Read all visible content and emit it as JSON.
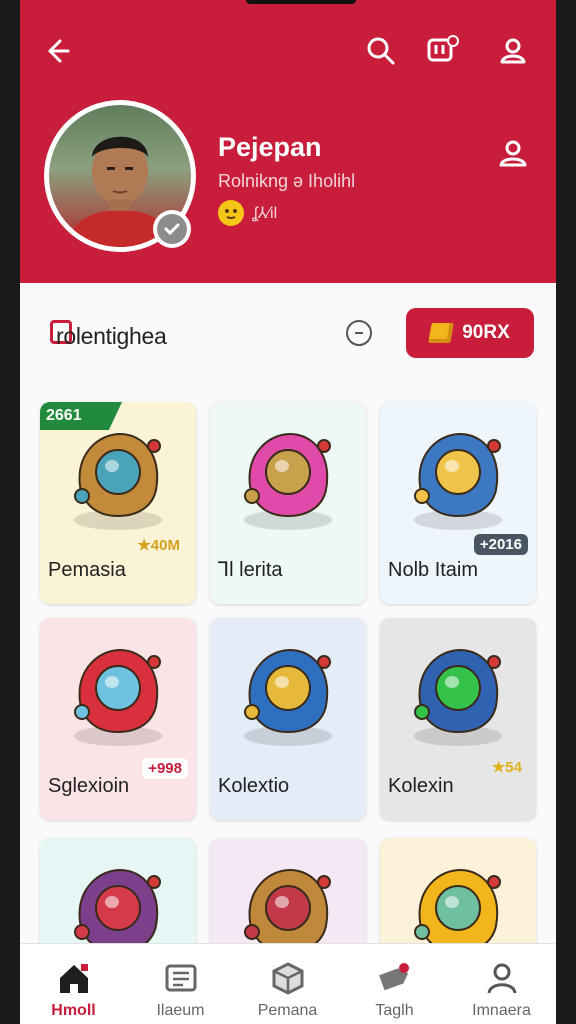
{
  "header": {
    "user_name": "Pejepan",
    "user_subtitle": "Rolnikng ə Iholihl",
    "status_text": "ʆ⅄∕il"
  },
  "section": {
    "title": "rolentighea",
    "buy_button_label": "90RX"
  },
  "items": [
    {
      "label": "Pemasia",
      "ribbon": "2661",
      "price": "★40M",
      "bg": "#fbf3d6"
    },
    {
      "label": "Ꞁl lerita",
      "bg": "#eef8f4"
    },
    {
      "label": "Nolb Itaim",
      "price": "+2016",
      "bg": "#eef5fb"
    },
    {
      "label": "Sglexioin",
      "price": "+998",
      "bg": "#fbe4e6"
    },
    {
      "label": "Kolextio",
      "bg": "#e3ecf7"
    },
    {
      "label": "Kolexin",
      "price": "★54",
      "bg": "#e6e6e6"
    },
    {
      "label": "",
      "bg": "#e6f6f4"
    },
    {
      "label": "",
      "bg": "#f3e8f4"
    },
    {
      "label": "",
      "bg": "#fbf2d9"
    }
  ],
  "tabs": [
    {
      "label": "Hmoll",
      "icon": "home-icon",
      "active": true
    },
    {
      "label": "Ilaeum",
      "icon": "news-icon"
    },
    {
      "label": "Pemana",
      "icon": "box-icon"
    },
    {
      "label": "Taglh",
      "icon": "tag-icon"
    },
    {
      "label": "Imnaera",
      "icon": "profile-icon"
    }
  ],
  "colors": {
    "brand": "#c81e3b",
    "ribbon": "#218a3c"
  }
}
